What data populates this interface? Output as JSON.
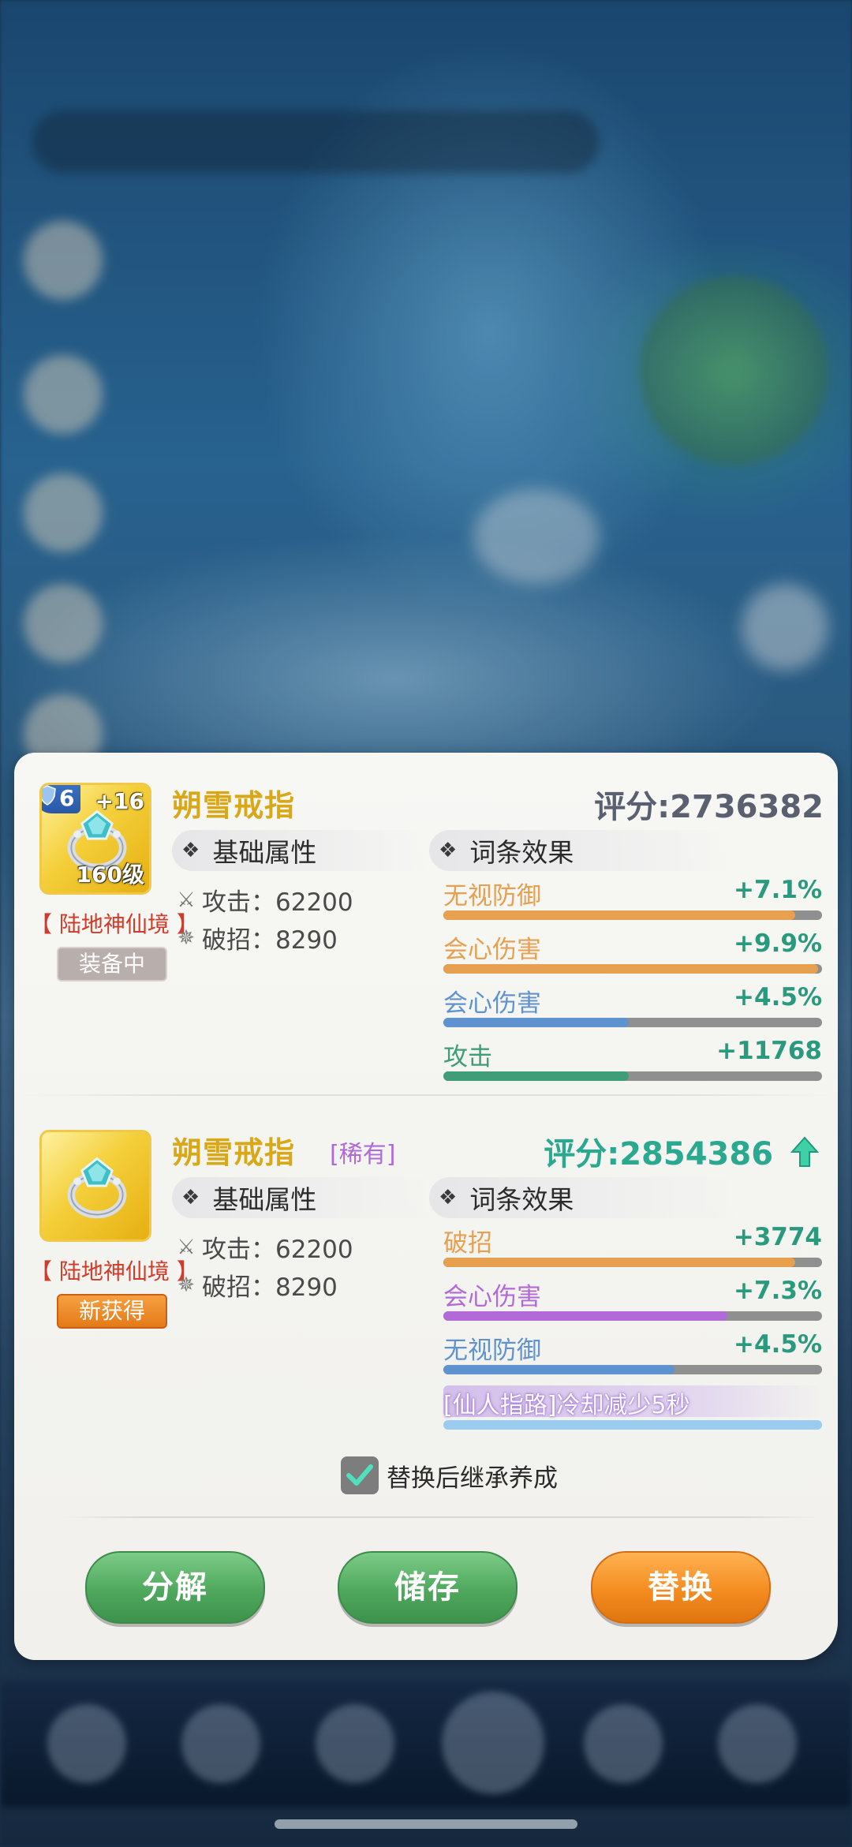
{
  "current_item": {
    "name": "朔雪戒指",
    "score": "评分:2736382",
    "tier": "6",
    "enhance": "+16",
    "level": "160级",
    "realm": "【 陆地神仙境 】",
    "status": "装备中",
    "base_header": "基础属性",
    "affix_header": "词条效果",
    "base_stats": [
      {
        "label": "攻击：62200",
        "icon": "sword-icon"
      },
      {
        "label": "破招：8290",
        "icon": "burst-icon"
      }
    ],
    "affixes": [
      {
        "label": "无视防御",
        "value": "+7.1%",
        "color": "#e6a050",
        "fill": 0.93
      },
      {
        "label": "会心伤害",
        "value": "+9.9%",
        "color": "#e6a050",
        "fill": 0.99
      },
      {
        "label": "会心伤害",
        "value": "+4.5%",
        "color": "#5f93d0",
        "fill": 0.49
      },
      {
        "label": "攻击",
        "value": "+11768",
        "color": "#3f9e78",
        "fill": 0.49
      }
    ]
  },
  "new_item": {
    "name": "朔雪戒指",
    "rarity": "[稀有]",
    "score": "评分:2854386",
    "realm": "【 陆地神仙境 】",
    "status": "新获得",
    "base_header": "基础属性",
    "affix_header": "词条效果",
    "base_stats": [
      {
        "label": "攻击：62200",
        "icon": "sword-icon"
      },
      {
        "label": "破招：8290",
        "icon": "burst-icon"
      }
    ],
    "affixes": [
      {
        "label": "破招",
        "value": "+3774",
        "color": "#e6a050",
        "fill": 0.93
      },
      {
        "label": "会心伤害",
        "value": "+7.3%",
        "color": "#b26ad8",
        "fill": 0.75
      },
      {
        "label": "无视防御",
        "value": "+4.5%",
        "color": "#5f93d0",
        "fill": 0.61
      }
    ],
    "special_effect": "[仙人指路]冷却减少5秒"
  },
  "inherit_label": "替换后继承养成",
  "inherit_checked": true,
  "buttons": {
    "decompose": "分解",
    "store": "储存",
    "replace": "替换"
  },
  "colors": {
    "name_gold": "#d9a818",
    "score_up": "#2aa890",
    "realm_red": "#d23a2a",
    "rarity_purple": "#b06ad8",
    "green_button": "#4fa85e",
    "orange_button": "#f48c20"
  }
}
